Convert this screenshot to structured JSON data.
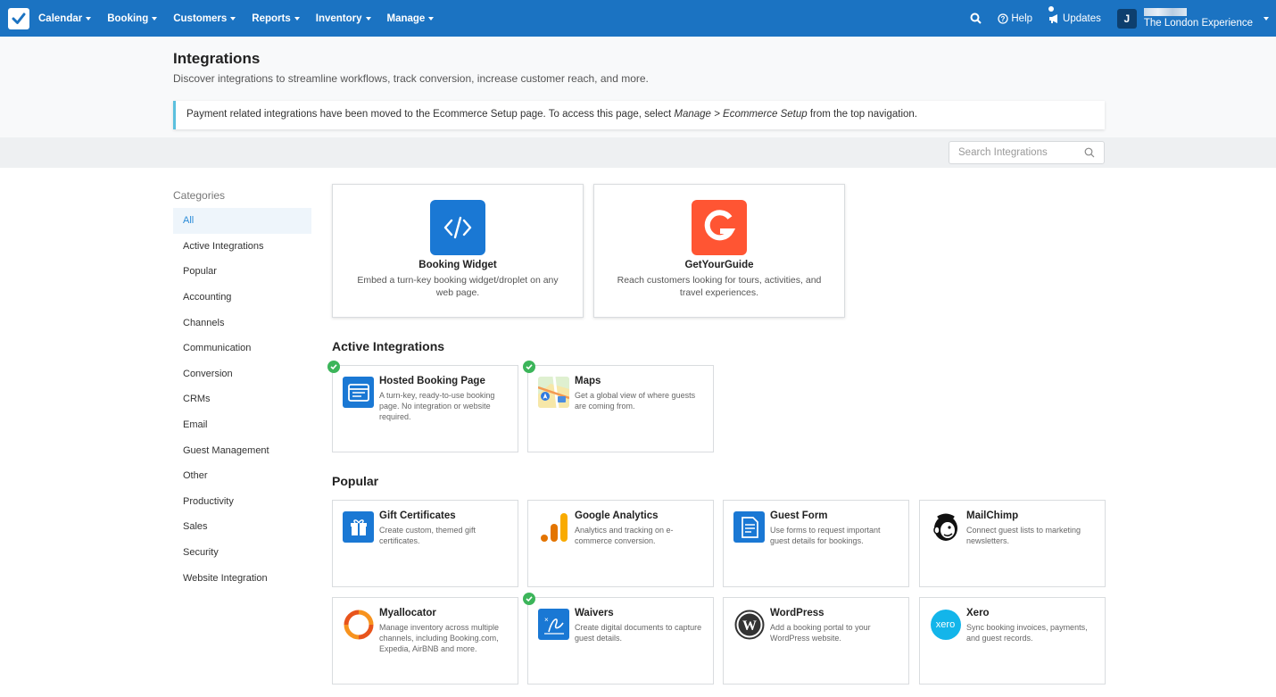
{
  "nav": {
    "items": [
      {
        "label": "Calendar"
      },
      {
        "label": "Booking"
      },
      {
        "label": "Customers"
      },
      {
        "label": "Reports"
      },
      {
        "label": "Inventory"
      },
      {
        "label": "Manage"
      }
    ],
    "help_label": "Help",
    "updates_label": "Updates",
    "avatar_letter": "J",
    "account_name": "The London Experience"
  },
  "header": {
    "title": "Integrations",
    "subtitle": "Discover integrations to streamline workflows, track conversion, increase customer reach, and more.",
    "notice_pre": "Payment related integrations have been moved to the Ecommerce Setup page. To access this page, select ",
    "notice_em": "Manage > Ecommerce Setup",
    "notice_post": " from the top navigation."
  },
  "search": {
    "placeholder": "Search Integrations"
  },
  "categories": {
    "title": "Categories",
    "items": [
      {
        "label": "All"
      },
      {
        "label": "Active Integrations"
      },
      {
        "label": "Popular"
      },
      {
        "label": "Accounting"
      },
      {
        "label": "Channels"
      },
      {
        "label": "Communication"
      },
      {
        "label": "Conversion"
      },
      {
        "label": "CRMs"
      },
      {
        "label": "Email"
      },
      {
        "label": "Guest Management"
      },
      {
        "label": "Other"
      },
      {
        "label": "Productivity"
      },
      {
        "label": "Sales"
      },
      {
        "label": "Security"
      },
      {
        "label": "Website Integration"
      }
    ]
  },
  "featured": [
    {
      "name": "Booking Widget",
      "desc": "Embed a turn-key booking widget/droplet on any web page.",
      "icon": "code-icon",
      "color": "#1a78d4"
    },
    {
      "name": "GetYourGuide",
      "desc": "Reach customers looking for tours, activities, and travel experiences.",
      "icon": "getyourguide-logo",
      "color": "#ff5533"
    }
  ],
  "active": {
    "title": "Active Integrations",
    "items": [
      {
        "name": "Hosted Booking Page",
        "desc": "A turn-key, ready-to-use booking page. No integration or website required.",
        "icon": "browser-icon"
      },
      {
        "name": "Maps",
        "desc": "Get a global view of where guests are coming from.",
        "icon": "maps-icon"
      }
    ]
  },
  "popular": {
    "title": "Popular",
    "items": [
      {
        "name": "Gift Certificates",
        "desc": "Create custom, themed gift certificates.",
        "icon": "gift-icon"
      },
      {
        "name": "Google Analytics",
        "desc": "Analytics and tracking on e-commerce conversion.",
        "icon": "analytics-icon"
      },
      {
        "name": "Guest Form",
        "desc": "Use forms to request important guest details for bookings.",
        "icon": "form-icon"
      },
      {
        "name": "MailChimp",
        "desc": "Connect guest lists to marketing newsletters.",
        "icon": "mailchimp-icon"
      },
      {
        "name": "Myallocator",
        "desc": "Manage inventory across multiple channels, including Booking.com, Expedia, AirBNB and more.",
        "icon": "myallocator-icon"
      },
      {
        "name": "Waivers",
        "desc": "Create digital documents to capture guest details.",
        "icon": "signature-icon"
      },
      {
        "name": "WordPress",
        "desc": "Add a booking portal to your WordPress website.",
        "icon": "wordpress-icon"
      },
      {
        "name": "Xero",
        "desc": "Sync booking invoices, payments, and guest records.",
        "icon": "xero-icon",
        "logo_text": "xero"
      }
    ]
  }
}
